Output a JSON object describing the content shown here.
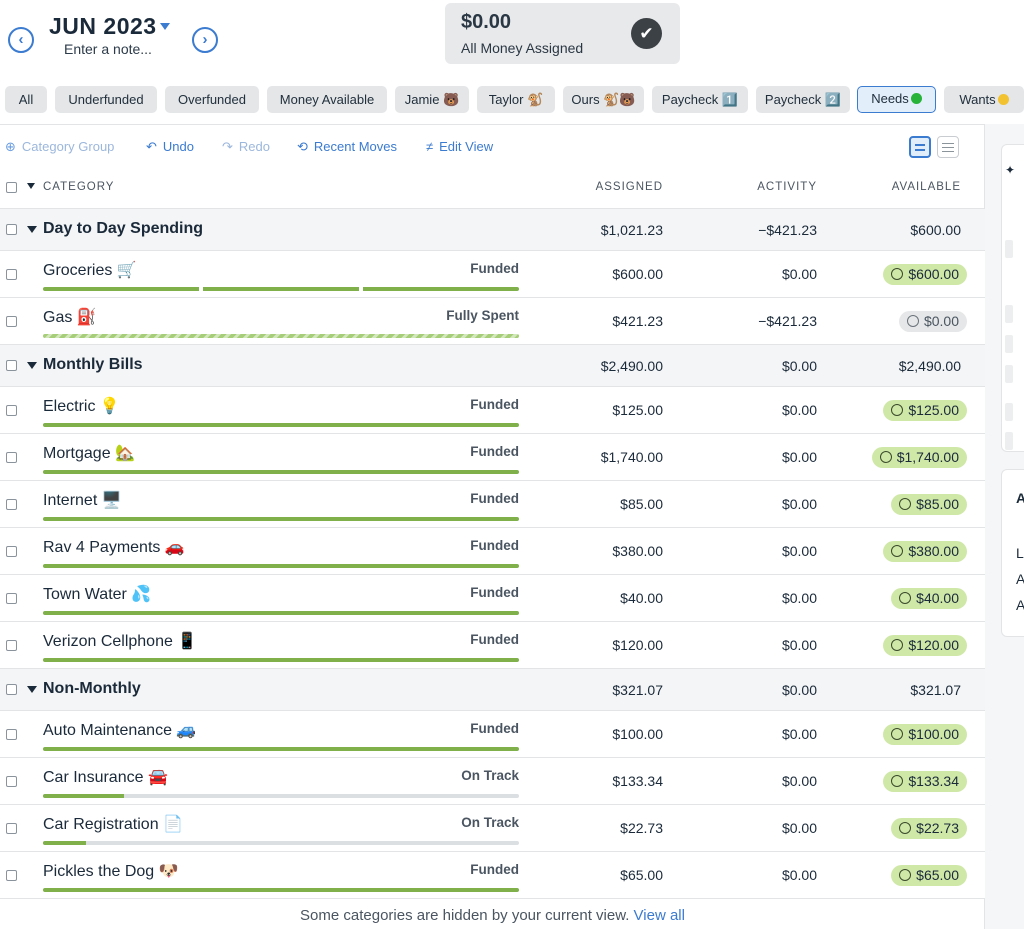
{
  "header": {
    "month": "JUN 2023",
    "note_placeholder": "Enter a note...",
    "prev_glyph": "‹",
    "next_glyph": "›",
    "summary_amount": "$0.00",
    "summary_label": "All Money Assigned",
    "summary_icon": "check-icon"
  },
  "filters": [
    {
      "label": "All"
    },
    {
      "label": "Underfunded"
    },
    {
      "label": "Overfunded"
    },
    {
      "label": "Money Available"
    },
    {
      "label": "Jamie 🐻"
    },
    {
      "label": "Taylor 🐒"
    },
    {
      "label": "Ours 🐒🐻"
    },
    {
      "label": "Paycheck 1️⃣"
    },
    {
      "label": "Paycheck 2️⃣"
    },
    {
      "label": "Needs",
      "active": true
    },
    {
      "label": "Wants"
    }
  ],
  "toolbar": {
    "category_group": "Category Group",
    "undo": "Undo",
    "redo": "Redo",
    "recent_moves": "Recent Moves",
    "edit_view": "Edit View"
  },
  "columns": {
    "category": "CATEGORY",
    "assigned": "ASSIGNED",
    "activity": "ACTIVITY",
    "available": "AVAILABLE"
  },
  "groups": [
    {
      "name": "Day to Day Spending",
      "assigned": "$1,021.23",
      "activity": "−$421.23",
      "available": "$600.00",
      "categories": [
        {
          "name": "Groceries 🛒",
          "status": "Funded",
          "assigned": "$600.00",
          "activity": "$0.00",
          "available": "$600.00",
          "bar": "segmented",
          "progress": 1.0,
          "pill": "green"
        },
        {
          "name": "Gas ⛽",
          "status": "Fully Spent",
          "assigned": "$421.23",
          "activity": "−$421.23",
          "available": "$0.00",
          "bar": "striped",
          "progress": 1.0,
          "pill": "gray"
        }
      ]
    },
    {
      "name": "Monthly Bills",
      "assigned": "$2,490.00",
      "activity": "$0.00",
      "available": "$2,490.00",
      "categories": [
        {
          "name": "Electric 💡",
          "status": "Funded",
          "assigned": "$125.00",
          "activity": "$0.00",
          "available": "$125.00",
          "bar": "solid",
          "progress": 1.0,
          "pill": "green"
        },
        {
          "name": "Mortgage 🏡",
          "status": "Funded",
          "assigned": "$1,740.00",
          "activity": "$0.00",
          "available": "$1,740.00",
          "bar": "solid",
          "progress": 1.0,
          "pill": "green"
        },
        {
          "name": "Internet 🖥️",
          "status": "Funded",
          "assigned": "$85.00",
          "activity": "$0.00",
          "available": "$85.00",
          "bar": "solid",
          "progress": 1.0,
          "pill": "green"
        },
        {
          "name": "Rav 4 Payments 🚗",
          "status": "Funded",
          "assigned": "$380.00",
          "activity": "$0.00",
          "available": "$380.00",
          "bar": "solid",
          "progress": 1.0,
          "pill": "green"
        },
        {
          "name": "Town Water 💦",
          "status": "Funded",
          "assigned": "$40.00",
          "activity": "$0.00",
          "available": "$40.00",
          "bar": "solid",
          "progress": 1.0,
          "pill": "green"
        },
        {
          "name": "Verizon Cellphone 📱",
          "status": "Funded",
          "assigned": "$120.00",
          "activity": "$0.00",
          "available": "$120.00",
          "bar": "solid",
          "progress": 1.0,
          "pill": "green"
        }
      ]
    },
    {
      "name": "Non-Monthly",
      "assigned": "$321.07",
      "activity": "$0.00",
      "available": "$321.07",
      "categories": [
        {
          "name": "Auto Maintenance 🚙",
          "status": "Funded",
          "assigned": "$100.00",
          "activity": "$0.00",
          "available": "$100.00",
          "bar": "solid",
          "progress": 1.0,
          "pill": "green"
        },
        {
          "name": "Car Insurance 🚘",
          "status": "On Track",
          "assigned": "$133.34",
          "activity": "$0.00",
          "available": "$133.34",
          "bar": "track",
          "progress": 0.17,
          "pill": "green"
        },
        {
          "name": "Car Registration 📄",
          "status": "On Track",
          "assigned": "$22.73",
          "activity": "$0.00",
          "available": "$22.73",
          "bar": "track",
          "progress": 0.09,
          "pill": "green"
        },
        {
          "name": "Pickles the Dog 🐶",
          "status": "Funded",
          "assigned": "$65.00",
          "activity": "$0.00",
          "available": "$65.00",
          "bar": "solid",
          "progress": 1.0,
          "pill": "green"
        }
      ]
    }
  ],
  "footer": {
    "text": "Some categories are hidden by your current view.",
    "link": "View all"
  },
  "right_panel": {
    "letters": [
      "L",
      "A",
      "A"
    ],
    "heading_letter": "A"
  },
  "colors": {
    "accent": "#3b7bd0",
    "funded_green": "#7fb04a",
    "pill_green": "#cfe8a8"
  }
}
